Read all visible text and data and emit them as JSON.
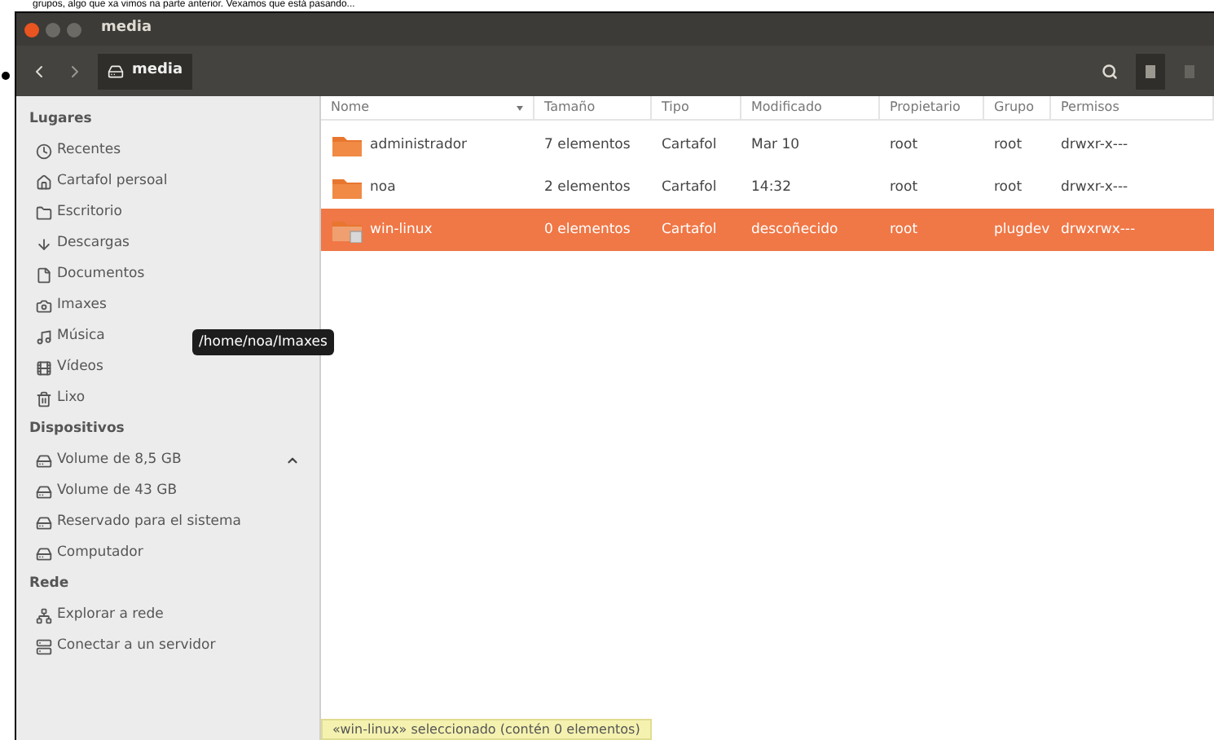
{
  "page_text": "grupos, algo que xa vimos na parte anterior. Vexamos que está pasando...",
  "window": {
    "title": "media"
  },
  "toolbar": {
    "location": "media",
    "view_buttons": [
      {
        "selected": true
      },
      {
        "selected": false
      }
    ]
  },
  "sidebar": {
    "sections": [
      {
        "heading": "Lugares",
        "items": [
          {
            "label": "Recentes"
          },
          {
            "label": "Cartafol persoal"
          },
          {
            "label": "Escritorio"
          },
          {
            "label": "Descargas"
          },
          {
            "label": "Documentos"
          },
          {
            "label": "Imaxes"
          },
          {
            "label": "Música"
          },
          {
            "label": "Vídeos"
          },
          {
            "label": "Lixo"
          }
        ]
      },
      {
        "heading": "Dispositivos",
        "items": [
          {
            "label": "Volume de 8,5 GB",
            "eject": true
          },
          {
            "label": "Volume de 43 GB",
            "eject": false
          },
          {
            "label": "Reservado para el sistema",
            "eject": false
          },
          {
            "label": "Computador",
            "eject": false
          }
        ]
      },
      {
        "heading": "Rede",
        "items": [
          {
            "label": "Explorar a rede"
          },
          {
            "label": "Conectar a un servidor"
          }
        ]
      }
    ]
  },
  "tooltip": "/home/noa/Imaxes",
  "table": {
    "columns": [
      "Nome",
      "Tamaño",
      "Tipo",
      "Modificado",
      "Propietario",
      "Grupo",
      "Permisos"
    ],
    "rows": [
      {
        "cells": [
          "administrador",
          "7 elementos",
          "Cartafol",
          "Mar 10",
          "root",
          "root",
          "drwxr-x---"
        ],
        "selected": false,
        "locked": false
      },
      {
        "cells": [
          "noa",
          "2 elementos",
          "Cartafol",
          "14:32",
          "root",
          "root",
          "drwxr-x---"
        ],
        "selected": false,
        "locked": false
      },
      {
        "cells": [
          "win-linux",
          "0 elementos",
          "Cartafol",
          "descoñecido",
          "root",
          "plugdev",
          "drwxrwx---"
        ],
        "selected": true,
        "locked": true
      }
    ]
  },
  "status_bar": "«win-linux» seleccionado (contén 0 elementos)"
}
